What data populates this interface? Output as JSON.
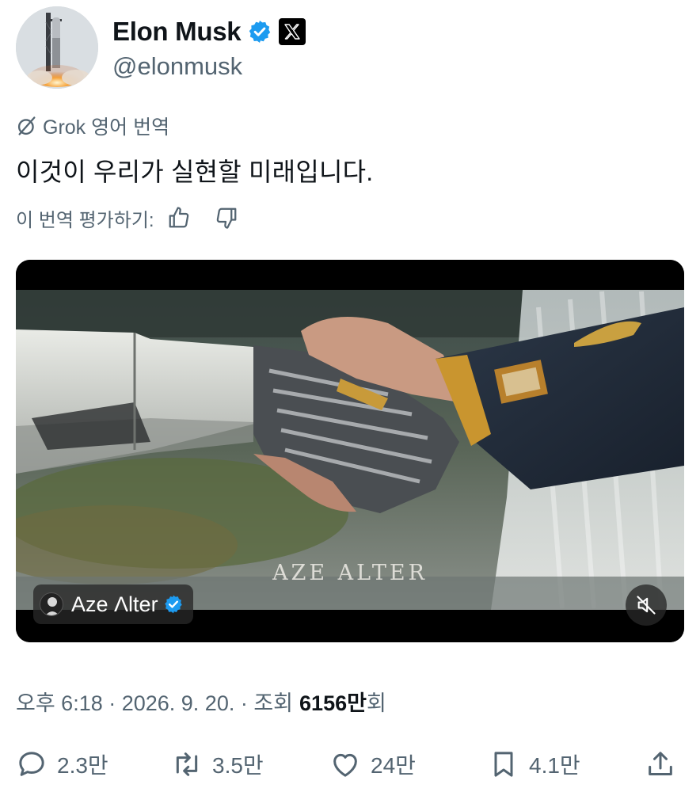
{
  "author": {
    "display_name": "Elon Musk",
    "handle": "@elonmusk",
    "verified_icon": "verified-badge-icon",
    "affiliation_icon": "x-logo-icon"
  },
  "translation": {
    "label": "Grok 영어 번역",
    "text": "이것이 우리가 실현할 미래입니다.",
    "rate_prompt": "이 번역 평가하기:"
  },
  "video": {
    "watermark": "AZE ALTER",
    "attribution_name": "Aze Λlter",
    "mute_icon": "speaker-muted-icon"
  },
  "meta": {
    "time_date": "오후 6:18 · 2026. 9. 20. · 조회",
    "views_number": "6156만",
    "views_suffix": "회"
  },
  "actions": {
    "replies": "2.3만",
    "reposts": "3.5만",
    "likes": "24만",
    "bookmarks": "4.1만"
  },
  "colors": {
    "text_primary": "#0f1419",
    "text_secondary": "#536471",
    "verified_blue": "#1d9bf0"
  }
}
